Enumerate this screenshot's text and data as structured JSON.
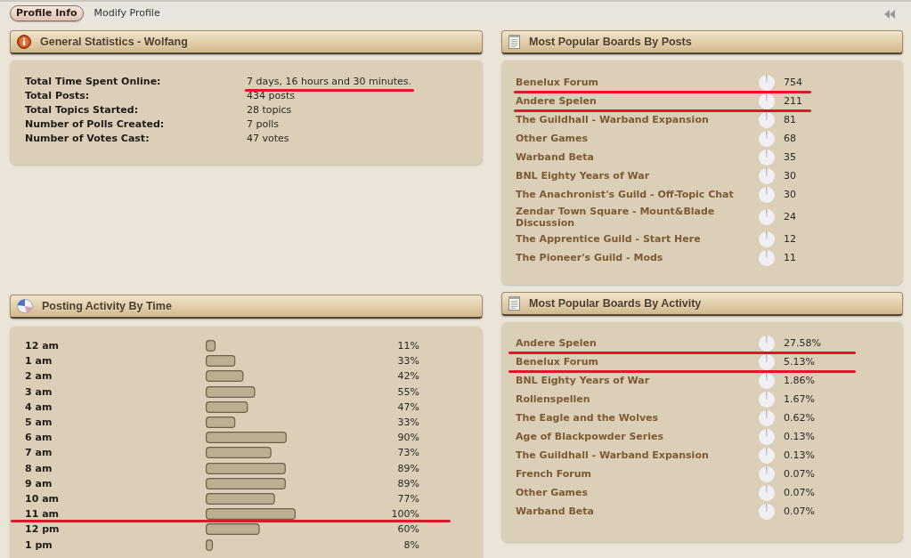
{
  "tabs": [
    {
      "label": "Profile Info",
      "selected": true
    },
    {
      "label": "Modify Profile",
      "selected": false
    }
  ],
  "general_statistics": {
    "title": "General Statistics - Wolfang",
    "rows": [
      {
        "label": "Total Time Spent Online:",
        "value": "7 days, 16 hours and 30 minutes.",
        "underlined": true
      },
      {
        "label": "Total Posts:",
        "value": "434 posts",
        "underlined": false
      },
      {
        "label": "Total Topics Started:",
        "value": "28 topics",
        "underlined": false
      },
      {
        "label": "Number of Polls Created:",
        "value": "7 polls",
        "underlined": false
      },
      {
        "label": "Number of Votes Cast:",
        "value": "47 votes",
        "underlined": false
      }
    ]
  },
  "boards_by_posts": {
    "title": "Most Popular Boards By Posts",
    "rows": [
      {
        "name": "Benelux Forum",
        "count": "754",
        "underlined": true
      },
      {
        "name": "Andere Spelen",
        "count": "211",
        "underlined": true
      },
      {
        "name": "The Guildhall - Warband Expansion",
        "count": "81",
        "underlined": false
      },
      {
        "name": "Other Games",
        "count": "68",
        "underlined": false
      },
      {
        "name": "Warband Beta",
        "count": "35",
        "underlined": false
      },
      {
        "name": "BNL Eighty Years of War",
        "count": "30",
        "underlined": false
      },
      {
        "name": "The Anachronist's Guild - Off-Topic Chat",
        "count": "30",
        "underlined": false
      },
      {
        "name": "Zendar Town Square - Mount&Blade Discussion",
        "count": "24",
        "underlined": false
      },
      {
        "name": "The Apprentice Guild - Start Here",
        "count": "12",
        "underlined": false
      },
      {
        "name": "The Pioneer's Guild - Mods",
        "count": "11",
        "underlined": false
      }
    ]
  },
  "posting_activity": {
    "title": "Posting Activity By Time",
    "rows": [
      {
        "underlined": false
      },
      {
        "underlined": false
      },
      {
        "underlined": false
      },
      {
        "underlined": false
      },
      {
        "underlined": false
      },
      {
        "underlined": false
      },
      {
        "underlined": false
      },
      {
        "underlined": false
      },
      {
        "underlined": false
      },
      {
        "underlined": false
      },
      {
        "underlined": false
      },
      {
        "underlined": true
      },
      {
        "underlined": false
      },
      {
        "underlined": false
      }
    ],
    "chart_data": {
      "type": "bar",
      "orientation": "horizontal",
      "categories": [
        "12 am",
        "1 am",
        "2 am",
        "3 am",
        "4 am",
        "5 am",
        "6 am",
        "7 am",
        "8 am",
        "9 am",
        "10 am",
        "11 am",
        "12 pm",
        "1 pm"
      ],
      "values": [
        11,
        33,
        42,
        55,
        47,
        33,
        90,
        73,
        89,
        89,
        77,
        100,
        60,
        8
      ],
      "value_labels": [
        "11%",
        "33%",
        "42%",
        "55%",
        "47%",
        "33%",
        "90%",
        "73%",
        "89%",
        "89%",
        "77%",
        "100%",
        "60%",
        "8%"
      ]
    }
  },
  "boards_by_activity": {
    "title": "Most Popular Boards By Activity",
    "rows": [
      {
        "name": "Andere Spelen",
        "reading": "27.58%",
        "underlined": true
      },
      {
        "name": "Benelux Forum",
        "reading": "5.13%",
        "underlined": true
      },
      {
        "name": "BNL Eighty Years of War",
        "reading": "1.86%",
        "underlined": false
      },
      {
        "name": "Rollenspellen",
        "reading": "1.67%",
        "underlined": false
      },
      {
        "name": "The Eagle and the Wolves",
        "reading": "0.62%",
        "underlined": false
      },
      {
        "name": "Age of Blackpowder Series",
        "reading": "0.13%",
        "underlined": false
      },
      {
        "name": "The Guildhall - Warband Expansion",
        "reading": "0.13%",
        "underlined": false
      },
      {
        "name": "French Forum",
        "reading": "0.07%",
        "underlined": false
      },
      {
        "name": "Other Games",
        "reading": "0.07%",
        "underlined": false
      },
      {
        "name": "Warband Beta",
        "reading": "0.07%",
        "underlined": false
      }
    ]
  }
}
